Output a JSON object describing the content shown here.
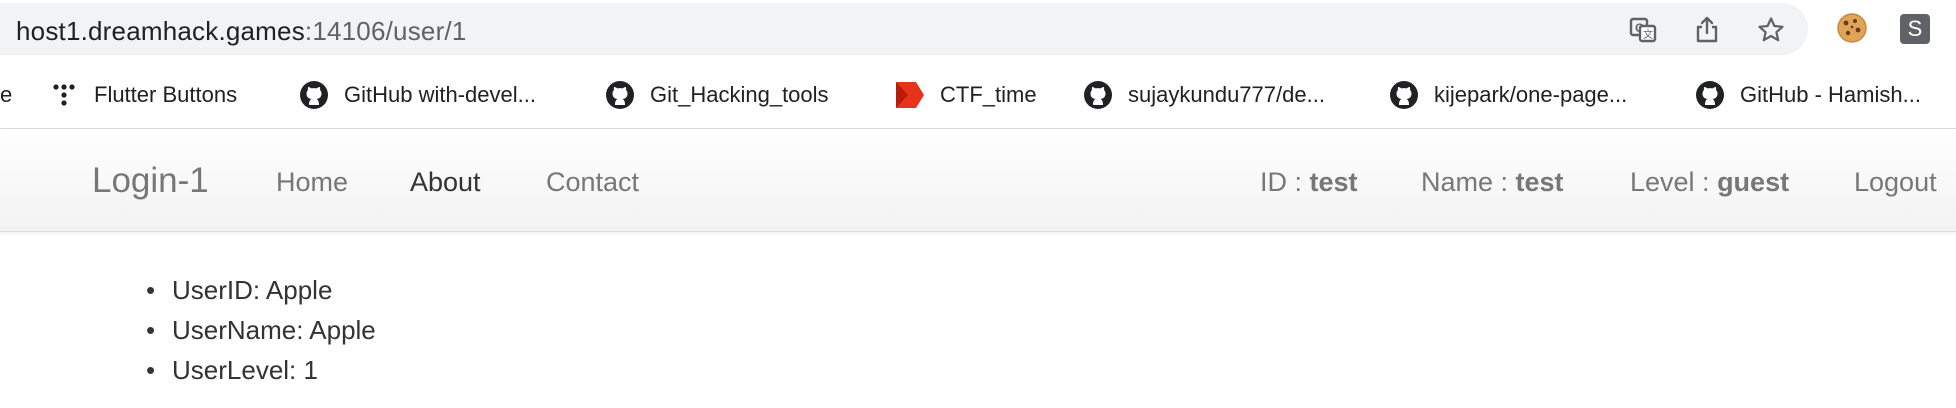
{
  "address_bar": {
    "url_host": "host1.dreamhack.games",
    "url_path": ":14106/user/1"
  },
  "toolbar": {
    "icons": [
      "translate-icon",
      "share-icon",
      "bookmark-star-icon",
      "cookie-extension-icon",
      "s-extension-icon"
    ],
    "s_extension_label": "S"
  },
  "bookmarks": [
    {
      "label": "e",
      "icon": "none"
    },
    {
      "label": "Flutter Buttons",
      "icon": "flutter-dots-icon"
    },
    {
      "label": "GitHub with-devel...",
      "icon": "github-icon"
    },
    {
      "label": "Git_Hacking_tools",
      "icon": "github-icon"
    },
    {
      "label": "CTF_time",
      "icon": "ctftime-icon"
    },
    {
      "label": "sujaykundu777/de...",
      "icon": "github-icon"
    },
    {
      "label": "kijepark/one-page...",
      "icon": "github-icon"
    },
    {
      "label": "GitHub - Hamish...",
      "icon": "github-icon"
    }
  ],
  "navbar": {
    "brand": "Login-1",
    "links": [
      "Home",
      "About",
      "Contact"
    ],
    "active_link": "About",
    "id_label": "ID : ",
    "id_value": "test",
    "name_label": "Name : ",
    "name_value": "test",
    "level_label": "Level : ",
    "level_value": "guest",
    "logout": "Logout"
  },
  "user_info": [
    "UserID: Apple",
    "UserName: Apple",
    "UserLevel: 1"
  ],
  "colors": {
    "omnibox_bg": "#f1f3f4",
    "nav_text": "#777777",
    "nav_active": "#333333"
  }
}
